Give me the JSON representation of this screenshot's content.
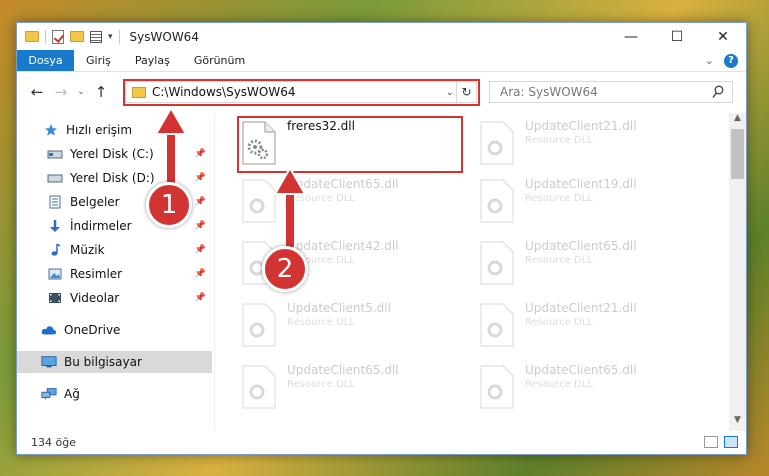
{
  "window": {
    "title": "SysWOW64",
    "controls": {
      "minimize": "—",
      "maximize": "☐",
      "close": "✕"
    }
  },
  "ribbon": {
    "file_tab": "Dosya",
    "tabs": [
      "Giriş",
      "Paylaş",
      "Görünüm"
    ],
    "expand": "⌄",
    "help": "?"
  },
  "navigation": {
    "back": "←",
    "forward": "→",
    "recent": "⌄",
    "up": "↑",
    "address": "C:\\Windows\\SysWOW64",
    "address_dropdown": "⌄",
    "refresh": "↻",
    "search_placeholder": "Ara: SysWOW64"
  },
  "sidebar": {
    "items": [
      {
        "label": "Hızlı erişim",
        "icon": "star-icon",
        "pinned": false
      },
      {
        "label": "Yerel Disk (C:)",
        "icon": "drive-icon",
        "pinned": true
      },
      {
        "label": "Yerel Disk (D:)",
        "icon": "drive-icon",
        "pinned": true
      },
      {
        "label": "Belgeler",
        "icon": "document-icon",
        "pinned": true
      },
      {
        "label": "İndirmeler",
        "icon": "download-icon",
        "pinned": true
      },
      {
        "label": "Müzik",
        "icon": "music-icon",
        "pinned": true
      },
      {
        "label": "Resimler",
        "icon": "pictures-icon",
        "pinned": true
      },
      {
        "label": "Videolar",
        "icon": "video-icon",
        "pinned": true
      },
      {
        "label": "OneDrive",
        "icon": "cloud-icon",
        "pinned": false
      },
      {
        "label": "Bu bilgisayar",
        "icon": "computer-icon",
        "pinned": false,
        "selected": true
      },
      {
        "label": "Ağ",
        "icon": "network-icon",
        "pinned": false
      }
    ],
    "pin_glyph": "📌"
  },
  "files": {
    "left": [
      {
        "name": "freres32.dll",
        "type": ""
      },
      {
        "name": "UpdateClient65.dll",
        "type": "Resource DLL"
      },
      {
        "name": "UpdateClient42.dll",
        "type": "Resource DLL"
      },
      {
        "name": "UpdateClient5.dll",
        "type": "Resource DLL"
      },
      {
        "name": "UpdateClient65.dll",
        "type": "Resource DLL"
      }
    ],
    "right": [
      {
        "name": "UpdateClient21.dll",
        "type": "Resource DLL"
      },
      {
        "name": "UpdateClient19.dll",
        "type": "Resource DLL"
      },
      {
        "name": "UpdateClient65.dll",
        "type": "Resource DLL"
      },
      {
        "name": "UpdateClient21.dll",
        "type": "Resource DLL"
      },
      {
        "name": "UpdateClient65.dll",
        "type": "Resource DLL"
      }
    ]
  },
  "status": {
    "count": "134 öğe"
  },
  "callouts": {
    "one": "1",
    "two": "2"
  },
  "colors": {
    "accent": "#1979ca",
    "highlight": "#d23434"
  }
}
